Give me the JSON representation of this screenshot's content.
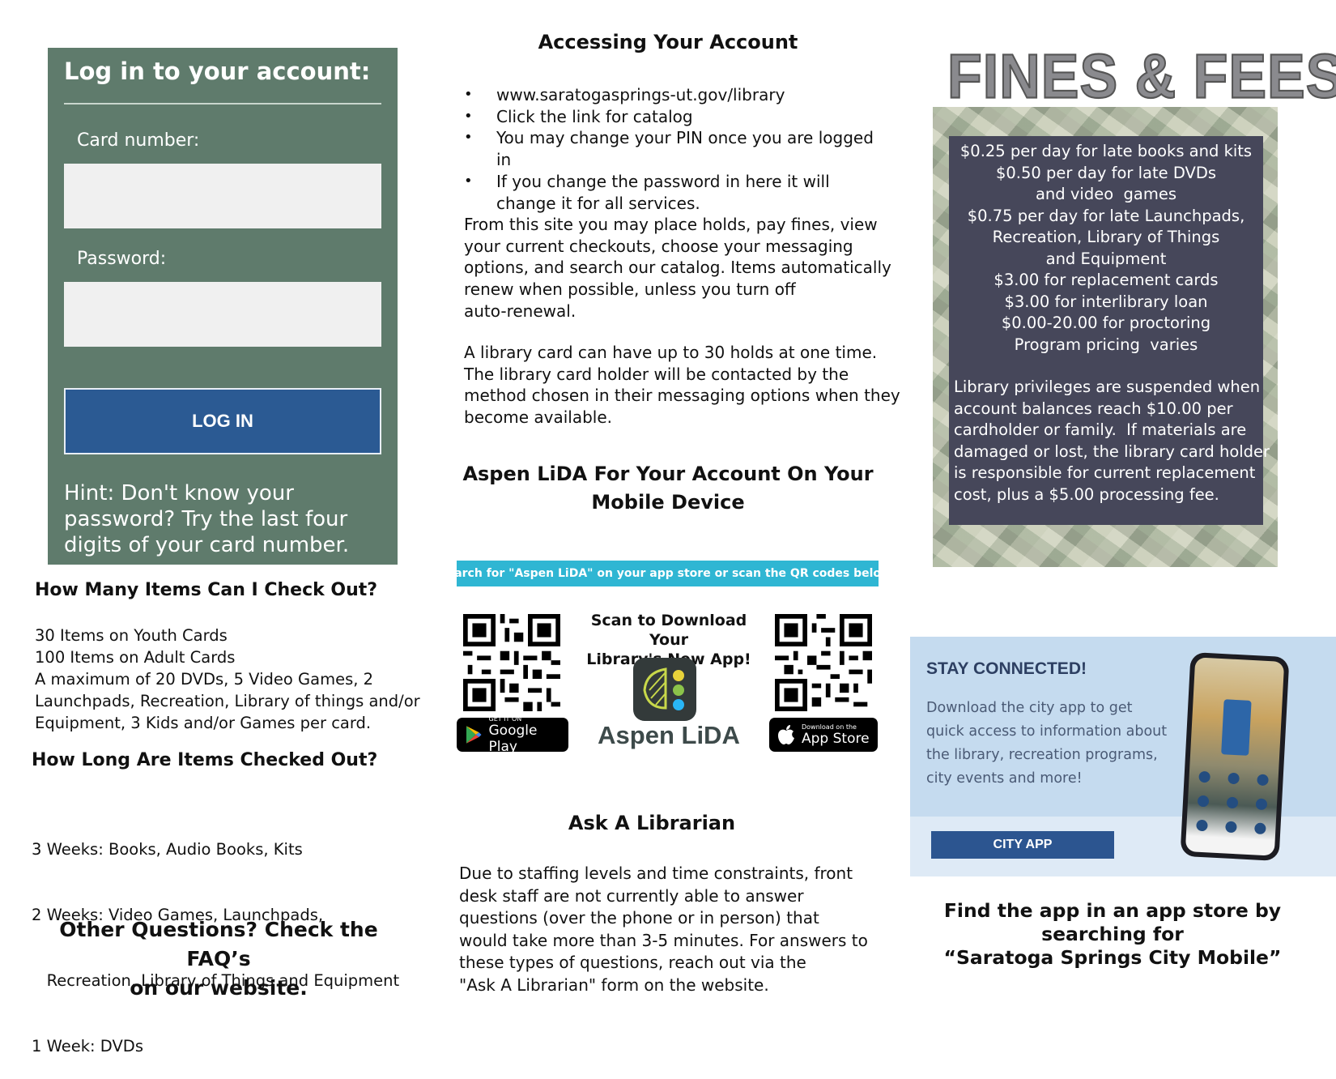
{
  "login": {
    "title": "Log in to your account:",
    "card_label": "Card number:",
    "card_value": "",
    "password_label": "Password:",
    "password_value": "",
    "button": "LOG IN",
    "hint_lines": [
      "Hint: Don't know your",
      "password? Try the last four",
      "digits of your card number."
    ]
  },
  "checkout": {
    "heading": "How Many Items Can I Check Out?",
    "lines": [
      "30 Items on Youth Cards",
      "100 Items on Adult Cards",
      "A maximum of 20 DVDs, 5 Video Games, 2",
      "Launchpads, Recreation, Library of things and/or",
      "Equipment, 3 Kids and/or Games per card."
    ]
  },
  "duration": {
    "heading": "How Long Are Items Checked Out?",
    "lines": [
      "3 Weeks: Books, Audio Books, Kits",
      "2 Weeks: Video Games, Launchpads,",
      "   Recreation, Library of Things and Equipment",
      "1 Week: DVDs"
    ]
  },
  "other_questions": {
    "line1": "Other Questions? Check the FAQ’s",
    "line2": "on our website."
  },
  "account": {
    "heading": "Accessing Your Account",
    "bullets": [
      "www.saratogasprings-ut.gov/library",
      "Click the link for catalog",
      "You may change your PIN once you are logged in",
      "If you change the password in here it will change it for all services."
    ],
    "para1": [
      "From this site you may place holds, pay fines, view",
      "your current checkouts, choose your messaging",
      "options, and search our catalog. Items automatically",
      "renew when possible, unless you turn off",
      "auto-renewal."
    ],
    "para2": [
      "A library card can have up to 30 holds at one time.",
      "The library card holder will be contacted by the",
      "method chosen in their messaging options when they",
      "become available."
    ]
  },
  "aspen": {
    "heading_line1": "Aspen LiDA For Your Account On Your",
    "heading_line2": "Mobile Device",
    "banner": "Search for \"Aspen LiDA\" on your app store or scan the QR codes below!",
    "scan_line1": "Scan to Download Your",
    "scan_line2": "Library's New App!",
    "app_name": "Aspen LiDA",
    "google_small": "GET IT ON",
    "google_big": "Google Play",
    "apple_small": "Download on the",
    "apple_big": "App Store"
  },
  "librarian": {
    "heading": "Ask A Librarian",
    "lines": [
      "Due to staffing levels and time constraints, front",
      "desk staff are not currently able to answer",
      "questions (over the phone or in person) that",
      "would take more than 3-5 minutes. For answers to",
      "these types of questions, reach out via the",
      "\"Ask A Librarian\" form on the website."
    ]
  },
  "fines": {
    "title": "FINES & FEES",
    "lines": [
      "$0.25 per day for late books and kits",
      "$0.50 per day for late DVDs",
      "and video  games",
      "$0.75 per day for late Launchpads,",
      "Recreation, Library of Things",
      "and Equipment",
      "$3.00 for replacement cards",
      "$3.00 for interlibrary loan",
      "$0.00-20.00 for proctoring",
      "Program pricing  varies"
    ],
    "note": [
      "Library privileges are suspended when",
      "account balances reach $10.00 per",
      "cardholder or family.  If materials are",
      "damaged or lost, the library card holder",
      "is responsible for current replacement",
      "cost, plus a $5.00 processing fee."
    ]
  },
  "city": {
    "heading": "STAY CONNECTED!",
    "lines": [
      "Download the city app to get",
      "quick access to information about",
      "the library, recreation programs,",
      "city events and more!"
    ],
    "button": "CITY APP",
    "find_line1": "Find the app in an app store by",
    "find_line2": "searching for",
    "find_line3": "“Saratoga Springs City Mobile”"
  },
  "colors": {
    "login_panel": "#5f7b6c",
    "login_button": "#2b5a93",
    "fines_box": "#46475a",
    "aspen_banner": "#2fb6d3",
    "city_card": "#c5dbef",
    "city_button": "#2c5590"
  }
}
